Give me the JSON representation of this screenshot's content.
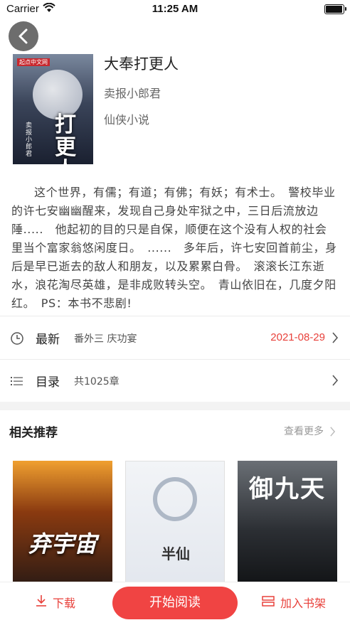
{
  "status_bar": {
    "carrier": "Carrier",
    "time": "11:25 AM",
    "battery_level": 0.95
  },
  "book": {
    "title": "大奉打更人",
    "author": "卖报小郎君",
    "category": "仙侠小说",
    "cover_title": "打更人",
    "cover_author": "卖报小郎君",
    "cover_tag": "起点中文网"
  },
  "synopsis": "这个世界，有儒；有道；有佛；有妖；有术士。　警校毕业的许七安幽幽醒来，发现自己身处牢狱之中，三日后流放边陲.....　他起初的目的只是自保，顺便在这个没有人权的社会里当个富家翁悠闲度日。　......　多年后，许七安回首前尘，身后是早已逝去的敌人和朋友，以及累累白骨。　滚滚长江东逝水，浪花淘尽英雄，是非成败转头空。　青山依旧在，几度夕阳红。　PS：本书不悲剧!",
  "latest": {
    "label": "最新",
    "chapter": "番外三 庆功宴",
    "date": "2021-08-29"
  },
  "toc": {
    "label": "目录",
    "count": "共1025章"
  },
  "recommend": {
    "title": "相关推荐",
    "more": "查看更多",
    "books": [
      {
        "cover_title": "弃宇宙"
      },
      {
        "cover_title": "半仙"
      },
      {
        "cover_title": "御九天"
      }
    ]
  },
  "bottom": {
    "download": "下载",
    "read": "开始阅读",
    "shelf": "加入书架"
  },
  "colors": {
    "accent": "#f04443",
    "date": "#e8413b"
  },
  "icons": [
    "back-arrow-icon",
    "clock-icon",
    "list-icon",
    "chevron-right-icon",
    "download-icon",
    "bookshelf-icon",
    "wifi-icon",
    "battery-icon"
  ]
}
